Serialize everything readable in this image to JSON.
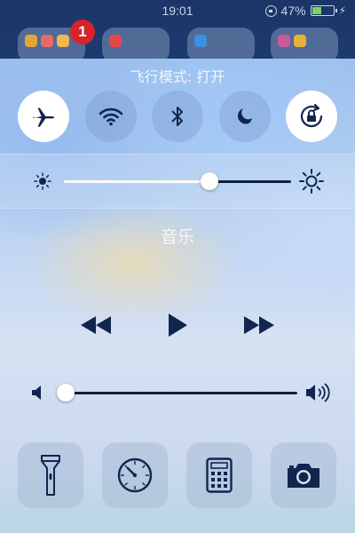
{
  "status_bar": {
    "time": "19:01",
    "battery_text": "47%",
    "battery_level": 0.47,
    "charging_icon": "bolt-icon",
    "rotation_lock_icon": "rotation-lock-icon"
  },
  "home_screen": {
    "badge_count": "1"
  },
  "control_center": {
    "airplane_mode_label": "飞行模式: 打开",
    "toggles": [
      {
        "name": "airplane-mode",
        "icon": "airplane-icon",
        "state": "on"
      },
      {
        "name": "wifi",
        "icon": "wifi-icon",
        "state": "off"
      },
      {
        "name": "bluetooth",
        "icon": "bluetooth-icon",
        "state": "off"
      },
      {
        "name": "do-not-disturb",
        "icon": "moon-icon",
        "state": "off"
      },
      {
        "name": "rotation-lock",
        "icon": "rotation-lock-icon",
        "state": "on"
      }
    ],
    "brightness": {
      "value": 0.64,
      "min_icon": "sun-small-icon",
      "max_icon": "sun-large-icon"
    },
    "music": {
      "title": "音乐",
      "controls": [
        "rewind-icon",
        "play-icon",
        "fast-forward-icon"
      ]
    },
    "volume": {
      "value": 0.0,
      "min_icon": "speaker-icon",
      "max_icon": "speaker-loud-icon"
    },
    "shortcuts": [
      {
        "name": "flashlight",
        "icon": "flashlight-icon"
      },
      {
        "name": "timer",
        "icon": "timer-icon"
      },
      {
        "name": "calculator",
        "icon": "calculator-icon"
      },
      {
        "name": "camera",
        "icon": "camera-icon"
      }
    ],
    "colors": {
      "icon_dark": "#10264f",
      "toggle_on_bg": "#ffffff",
      "slider_filled": "#ffffff",
      "slider_empty": "#0e1f3d",
      "battery_green": "#7ad65a",
      "badge_red": "#d8232a"
    }
  }
}
